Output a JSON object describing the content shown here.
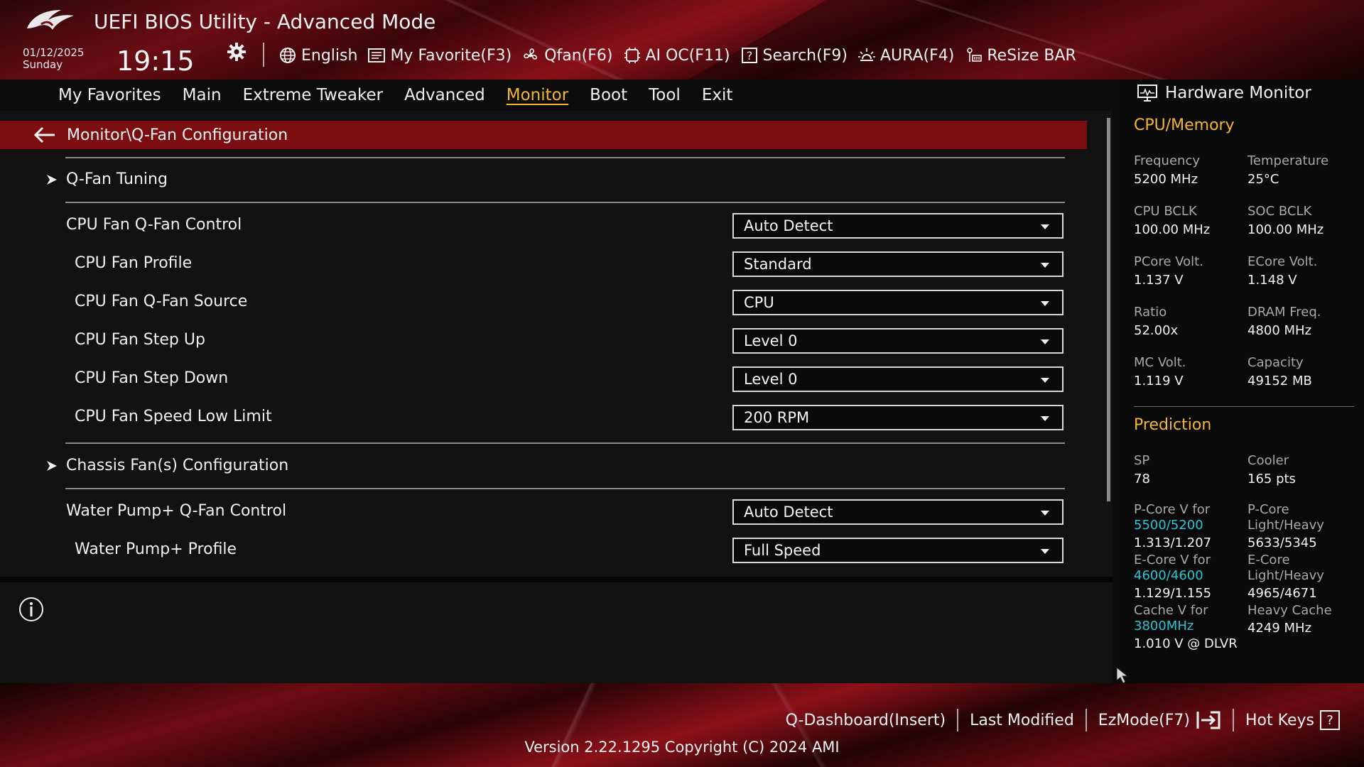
{
  "header": {
    "title": "UEFI BIOS Utility - Advanced Mode",
    "date": "01/12/2025",
    "day": "Sunday",
    "time": "19:15"
  },
  "toolbar": [
    {
      "label": "English",
      "icon": "globe-icon"
    },
    {
      "label": "My Favorite(F3)",
      "icon": "favorite-list-icon"
    },
    {
      "label": "Qfan(F6)",
      "icon": "fan-icon"
    },
    {
      "label": "AI OC(F11)",
      "icon": "ai-chip-icon"
    },
    {
      "label": "Search(F9)",
      "icon": "search-question-icon"
    },
    {
      "label": "AURA(F4)",
      "icon": "aura-light-icon"
    },
    {
      "label": "ReSize BAR",
      "icon": "resize-bar-icon"
    }
  ],
  "nav": {
    "tabs": [
      "My Favorites",
      "Main",
      "Extreme Tweaker",
      "Advanced",
      "Monitor",
      "Boot",
      "Tool",
      "Exit"
    ],
    "active": "Monitor"
  },
  "main": {
    "breadcrumb": "Monitor\\Q-Fan Configuration",
    "items": [
      {
        "type": "submenu",
        "label": "Q-Fan Tuning"
      },
      {
        "type": "setting",
        "label": "CPU Fan Q-Fan Control",
        "value": "Auto Detect",
        "indent": 0
      },
      {
        "type": "setting",
        "label": "CPU Fan Profile",
        "value": "Standard",
        "indent": 1
      },
      {
        "type": "setting",
        "label": "CPU Fan Q-Fan Source",
        "value": "CPU",
        "indent": 1
      },
      {
        "type": "setting",
        "label": "CPU Fan Step Up",
        "value": "Level 0",
        "indent": 1
      },
      {
        "type": "setting",
        "label": "CPU Fan Step Down",
        "value": "Level 0",
        "indent": 1
      },
      {
        "type": "setting",
        "label": "CPU Fan Speed Low Limit",
        "value": "200 RPM",
        "indent": 1
      },
      {
        "type": "submenu",
        "label": "Chassis Fan(s) Configuration"
      },
      {
        "type": "setting",
        "label": "Water Pump+ Q-Fan Control",
        "value": "Auto Detect",
        "indent": 0
      },
      {
        "type": "setting",
        "label": "Water Pump+ Profile",
        "value": "Full Speed",
        "indent": 1
      }
    ]
  },
  "hardware_monitor": {
    "title": "Hardware Monitor",
    "cpu_memory": {
      "heading": "CPU/Memory",
      "cells": [
        {
          "k": "Frequency",
          "v": "5200 MHz"
        },
        {
          "k": "Temperature",
          "v": "25°C"
        },
        {
          "k": "CPU BCLK",
          "v": "100.00 MHz"
        },
        {
          "k": "SOC BCLK",
          "v": "100.00 MHz"
        },
        {
          "k": "PCore Volt.",
          "v": "1.137 V"
        },
        {
          "k": "ECore Volt.",
          "v": "1.148 V"
        },
        {
          "k": "Ratio",
          "v": "52.00x"
        },
        {
          "k": "DRAM Freq.",
          "v": "4800 MHz"
        },
        {
          "k": "MC Volt.",
          "v": "1.119 V"
        },
        {
          "k": "Capacity",
          "v": "49152 MB"
        }
      ]
    },
    "prediction": {
      "heading": "Prediction",
      "sp_label": "SP",
      "sp_value": "78",
      "cooler_label": "Cooler",
      "cooler_value": "165 pts",
      "pcore_v_label": "P-Core V for",
      "pcore_v_freq": "5500/5200",
      "pcore_v_value": "1.313/1.207",
      "pcore_lh_label1": "P-Core",
      "pcore_lh_label2": "Light/Heavy",
      "pcore_lh_value": "5633/5345",
      "ecore_v_label": "E-Core V for",
      "ecore_v_freq": "4600/4600",
      "ecore_v_value": "1.129/1.155",
      "ecore_lh_label1": "E-Core",
      "ecore_lh_label2": "Light/Heavy",
      "ecore_lh_value": "4965/4671",
      "cache_v_label": "Cache V for",
      "cache_v_freq": "3800MHz",
      "cache_v_value": "1.010 V @ DLVR",
      "heavy_cache_label": "Heavy Cache",
      "heavy_cache_value": "4249 MHz"
    }
  },
  "footer": {
    "links": [
      "Q-Dashboard(Insert)",
      "Last Modified",
      "EzMode(F7)",
      "Hot Keys"
    ],
    "hotkeys_glyph": "?",
    "version": "Version 2.22.1295 Copyright (C) 2024 AMI"
  },
  "colors": {
    "accent_gold": "#f2b632",
    "brand_red": "#7c0e12",
    "link_cyan": "#27c6d6"
  }
}
